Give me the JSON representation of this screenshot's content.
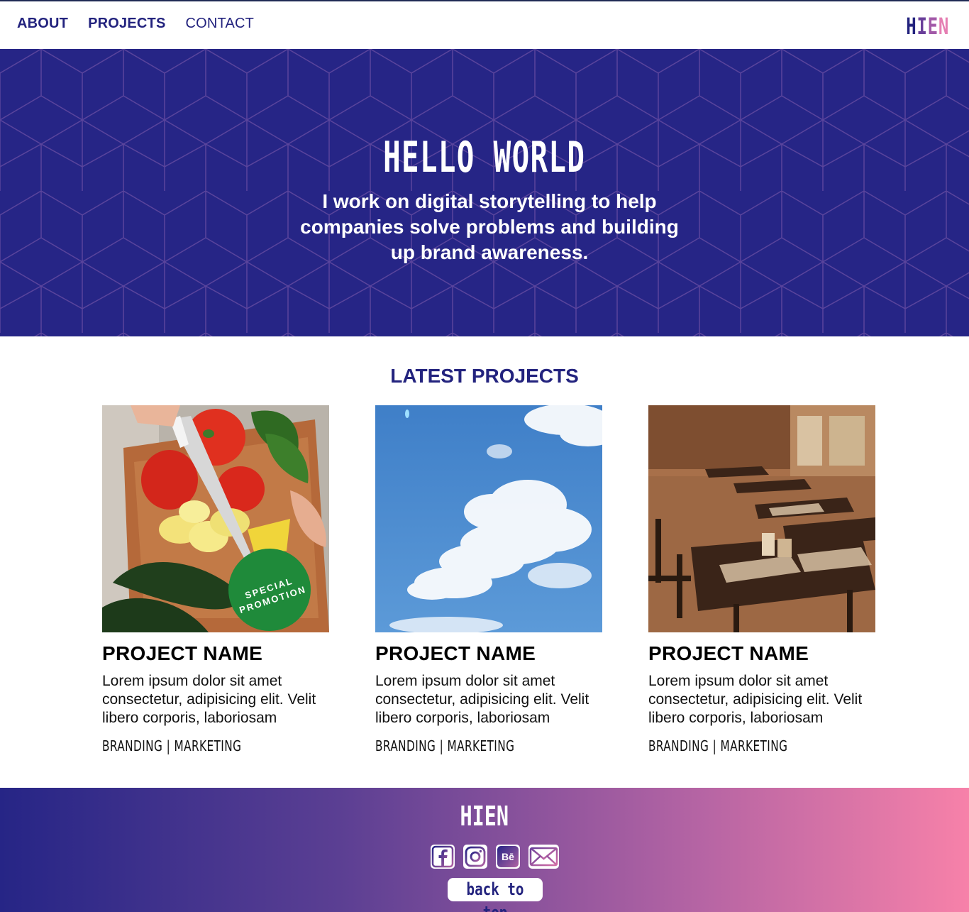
{
  "nav": {
    "links": [
      "ABOUT",
      "PROJECTS",
      "CONTACT"
    ],
    "logo": [
      "H",
      "I",
      "E",
      "N"
    ]
  },
  "hero": {
    "title": "HELLO WORLD",
    "subtitle": "I work on digital storytelling to help companies solve problems and building up brand awareness."
  },
  "projects": {
    "heading": "LATEST PROJECTS",
    "items": [
      {
        "image": "vegetables-cutting-board-image",
        "badge": [
          "SPECIAL",
          "PROMOTION"
        ],
        "title": "PROJECT NAME",
        "description": "Lorem ipsum dolor sit amet consectetur, adipisicing elit. Velit libero corporis, laboriosam",
        "tags": "BRANDING | MARKETING"
      },
      {
        "image": "blue-sky-clouds-image",
        "title": "PROJECT NAME",
        "description": "Lorem ipsum dolor sit amet consectetur, adipisicing elit. Velit libero corporis, laboriosam",
        "tags": "BRANDING | MARKETING"
      },
      {
        "image": "restaurant-interior-image",
        "title": "PROJECT NAME",
        "description": "Lorem ipsum dolor sit amet consectetur, adipisicing elit. Velit libero corporis, laboriosam",
        "tags": "BRANDING | MARKETING"
      }
    ]
  },
  "footer": {
    "logo": "HIEN",
    "socials": [
      "facebook-icon",
      "instagram-icon",
      "behance-icon",
      "mail-icon"
    ],
    "behance_text": "Bē",
    "back_to_top": "back to top"
  },
  "colors": {
    "navy": "#23237e",
    "hero_bg": "#262586",
    "gradient_start": "#262586",
    "gradient_end": "#f781a9"
  }
}
